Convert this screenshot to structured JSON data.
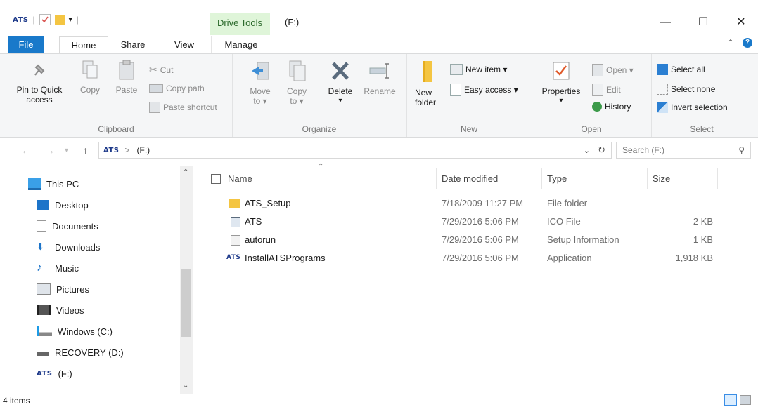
{
  "window": {
    "qat_logo": "ATS",
    "context_tab": "Drive Tools",
    "title": "(F:)",
    "controls": {
      "minimize": "—",
      "maximize": "☐",
      "close": "✕"
    }
  },
  "tabs": {
    "file": "File",
    "home": "Home",
    "share": "Share",
    "view": "View",
    "manage": "Manage"
  },
  "ribbon": {
    "clipboard": {
      "label": "Clipboard",
      "pin_line1": "Pin to Quick",
      "pin_line2": "access",
      "copy": "Copy",
      "paste": "Paste",
      "cut": "Cut",
      "copy_path": "Copy path",
      "paste_shortcut": "Paste shortcut"
    },
    "organize": {
      "label": "Organize",
      "move_to_1": "Move",
      "move_to_2": "to ▾",
      "copy_to_1": "Copy",
      "copy_to_2": "to ▾",
      "delete": "Delete",
      "delete_arrow": "▾",
      "rename": "Rename"
    },
    "new": {
      "label": "New",
      "new_folder_1": "New",
      "new_folder_2": "folder",
      "new_item": "New item ▾",
      "easy_access": "Easy access ▾"
    },
    "open": {
      "label": "Open",
      "properties": "Properties",
      "properties_arrow": "▾",
      "open": "Open ▾",
      "edit": "Edit",
      "history": "History"
    },
    "select": {
      "label": "Select",
      "select_all": "Select all",
      "select_none": "Select none",
      "invert": "Invert selection"
    }
  },
  "address": {
    "crumb_logo": "ATS",
    "crumb_sep": ">",
    "crumb_current": "(F:)",
    "search_placeholder": "Search (F:)"
  },
  "nav": {
    "items": [
      {
        "label": "This PC"
      },
      {
        "label": "Desktop"
      },
      {
        "label": "Documents"
      },
      {
        "label": "Downloads"
      },
      {
        "label": "Music"
      },
      {
        "label": "Pictures"
      },
      {
        "label": "Videos"
      },
      {
        "label": "Windows (C:)"
      },
      {
        "label": "RECOVERY (D:)"
      },
      {
        "label": "(F:)",
        "logo": "ATS"
      }
    ]
  },
  "columns": {
    "name": "Name",
    "date": "Date modified",
    "type": "Type",
    "size": "Size"
  },
  "files": [
    {
      "name": "ATS_Setup",
      "date": "7/18/2009 11:27 PM",
      "type": "File folder",
      "size": ""
    },
    {
      "name": "ATS",
      "date": "7/29/2016 5:06 PM",
      "type": "ICO File",
      "size": "2 KB"
    },
    {
      "name": "autorun",
      "date": "7/29/2016 5:06 PM",
      "type": "Setup Information",
      "size": "1 KB"
    },
    {
      "name": "InstallATSPrograms",
      "date": "7/29/2016 5:06 PM",
      "type": "Application",
      "size": "1,918 KB",
      "logo": "ATS"
    }
  ],
  "status": {
    "items": "4 items"
  },
  "colors": {
    "file_tab": "#1979ca",
    "drive_tools_bg": "#dff5d9",
    "folder": "#f4c542",
    "accent_blue": "#1e73be"
  }
}
